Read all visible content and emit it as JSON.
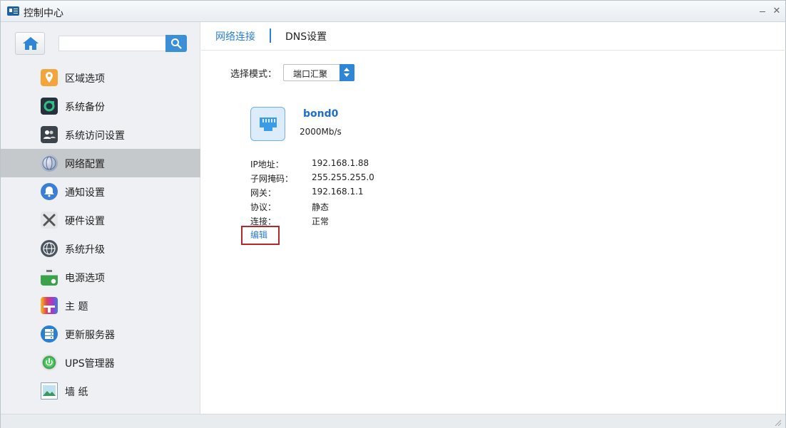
{
  "window": {
    "title": "控制中心"
  },
  "sidebar": {
    "search_placeholder": "",
    "items": [
      {
        "label": "区域选项",
        "icon": "location-pin-icon",
        "color": "#f0a040"
      },
      {
        "label": "系统备份",
        "icon": "backup-icon",
        "color": "#1f9e6e"
      },
      {
        "label": "系统访问设置",
        "icon": "users-icon",
        "color": "#444a52"
      },
      {
        "label": "网络配置",
        "icon": "network-globe-icon",
        "color": "#7a8fb0",
        "active": true
      },
      {
        "label": "通知设置",
        "icon": "bell-icon",
        "color": "#3a7fd6"
      },
      {
        "label": "硬件设置",
        "icon": "tools-icon",
        "color": "#8a9099"
      },
      {
        "label": "系统升级",
        "icon": "globe-upgrade-icon",
        "color": "#4a5560"
      },
      {
        "label": "电源选项",
        "icon": "battery-icon",
        "color": "#3aa34a"
      },
      {
        "label": "主 题",
        "icon": "palette-icon",
        "color": "#e0405a"
      },
      {
        "label": "更新服务器",
        "icon": "server-icon",
        "color": "#2a7fd2"
      },
      {
        "label": "UPS管理器",
        "icon": "ups-icon",
        "color": "#1e9a3a"
      },
      {
        "label": "墙 纸",
        "icon": "picture-icon",
        "color": "#5aa0c8"
      }
    ]
  },
  "tabs": {
    "network": "网络连接",
    "dns": "DNS设置"
  },
  "mode": {
    "label": "选择模式：",
    "value": "端口汇聚"
  },
  "interface": {
    "name": "bond0",
    "speed": "2000Mb/s",
    "icon": "ethernet-port-icon",
    "rows": [
      {
        "key": "IP地址：",
        "value": "192.168.1.88"
      },
      {
        "key": "子网掩码：",
        "value": "255.255.255.0"
      },
      {
        "key": "网关：",
        "value": "192.168.1.1"
      },
      {
        "key": "协议：",
        "value": "静态"
      },
      {
        "key": "连接：",
        "value": "正常"
      }
    ],
    "edit_label": "编辑"
  },
  "colors": {
    "accent": "#2a7fd2",
    "highlight_box": "#b3262a",
    "sidebar_active": "#c6c9cc"
  }
}
